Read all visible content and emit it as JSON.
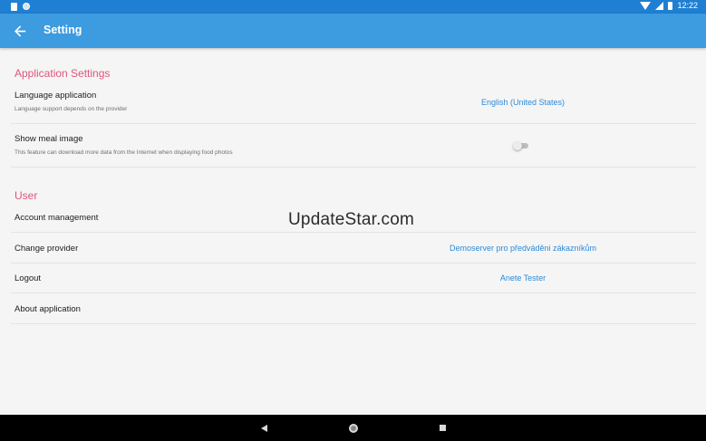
{
  "status_bar": {
    "time": "12:22",
    "icons": [
      "sd-card-icon",
      "sync-icon",
      "wifi-icon",
      "signal-icon",
      "battery-icon"
    ]
  },
  "app_bar": {
    "title": "Setting",
    "back_icon": "arrow-left-icon",
    "background": "#3d9be0"
  },
  "sections": {
    "application": {
      "header": "Application Settings",
      "language": {
        "title": "Language application",
        "subtitle": "Language support depends on the provider",
        "value": "English (United States)"
      },
      "meal_image": {
        "title": "Show meal image",
        "subtitle": "This feature can download more data from the Internet when displaying food photos",
        "enabled": false
      }
    },
    "user": {
      "header": "User",
      "account": {
        "title": "Account management"
      },
      "provider": {
        "title": "Change provider",
        "value": "Demoserver pro předváděni zákazníkům"
      },
      "logout": {
        "title": "Logout",
        "value": "Anete Tester"
      },
      "about": {
        "title": "About application"
      }
    }
  },
  "watermark": "UpdateStar.com",
  "nav_bar": {
    "icons": [
      "back-triangle-icon",
      "home-circle-icon",
      "recents-square-icon"
    ]
  },
  "colors": {
    "accent": "#e0557d",
    "link": "#2d8ad8",
    "status_bar": "#1f7fd3"
  }
}
